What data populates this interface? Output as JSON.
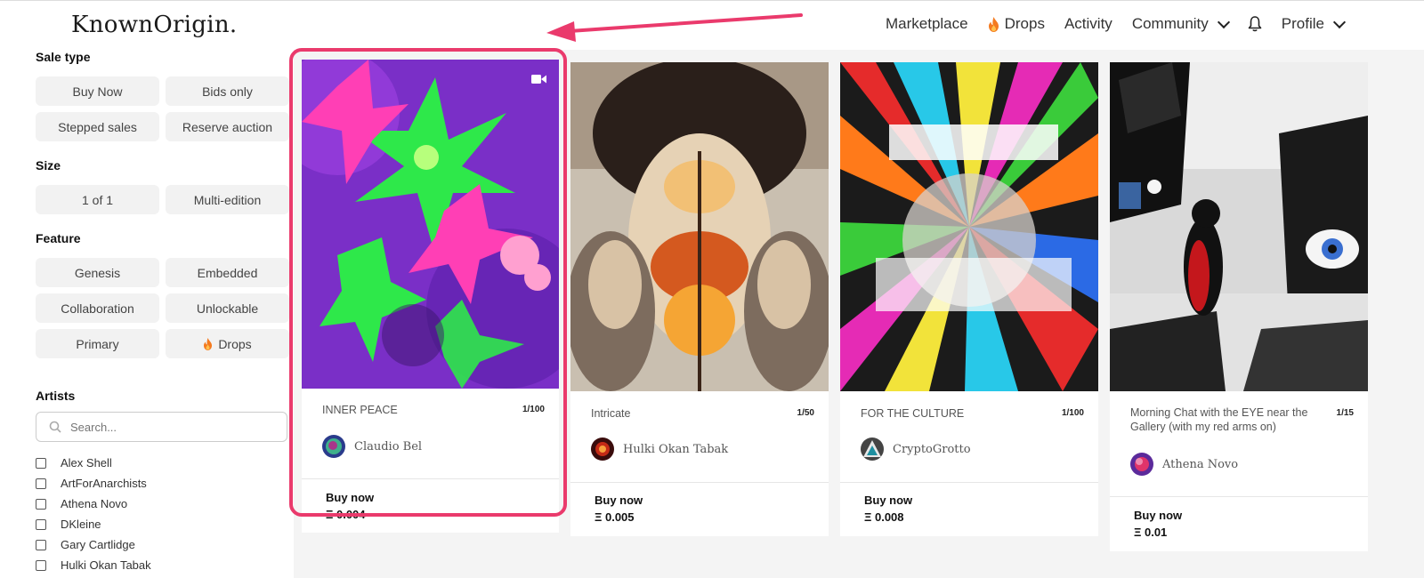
{
  "header": {
    "logo": "KnownOrigin.",
    "nav": {
      "marketplace": "Marketplace",
      "drops": "Drops",
      "activity": "Activity",
      "community": "Community",
      "profile": "Profile"
    }
  },
  "sidebar": {
    "sale_type": {
      "title": "Sale type",
      "options": [
        "Buy Now",
        "Bids only",
        "Stepped sales",
        "Reserve auction"
      ]
    },
    "size": {
      "title": "Size",
      "options": [
        "1 of 1",
        "Multi-edition"
      ]
    },
    "feature": {
      "title": "Feature",
      "options": [
        "Genesis",
        "Embedded",
        "Collaboration",
        "Unlockable",
        "Primary",
        "Drops"
      ]
    },
    "artists": {
      "title": "Artists",
      "search_placeholder": "Search...",
      "items": [
        "Alex Shell",
        "ArtForAnarchists",
        "Athena Novo",
        "DKleine",
        "Gary Cartlidge",
        "Hulki Okan Tabak"
      ]
    }
  },
  "cards": [
    {
      "title": "INNER PEACE",
      "edition": "1/100",
      "artist": "Claudio Bel",
      "buy_label": "Buy now",
      "price": "Ξ 0.004"
    },
    {
      "title": "Intricate",
      "edition": "1/50",
      "artist": "Hulki Okan Tabak",
      "buy_label": "Buy now",
      "price": "Ξ 0.005"
    },
    {
      "title": "FOR THE CULTURE",
      "edition": "1/100",
      "artist": "CryptoGrotto",
      "buy_label": "Buy now",
      "price": "Ξ 0.008"
    },
    {
      "title": "Morning Chat with the EYE near the Gallery (with my red arms on)",
      "edition": "1/15",
      "artist": "Athena Novo",
      "buy_label": "Buy now",
      "price": "Ξ 0.01"
    }
  ],
  "colors": {
    "highlight": "#ea3a6c",
    "flame": "#f47a1f",
    "chip_bg": "#f2f2f2",
    "grid_bg": "#f4f4f4"
  },
  "icons": [
    "flame-icon",
    "bell-icon",
    "chevron-down-icon",
    "search-icon",
    "video-icon",
    "checkbox"
  ]
}
